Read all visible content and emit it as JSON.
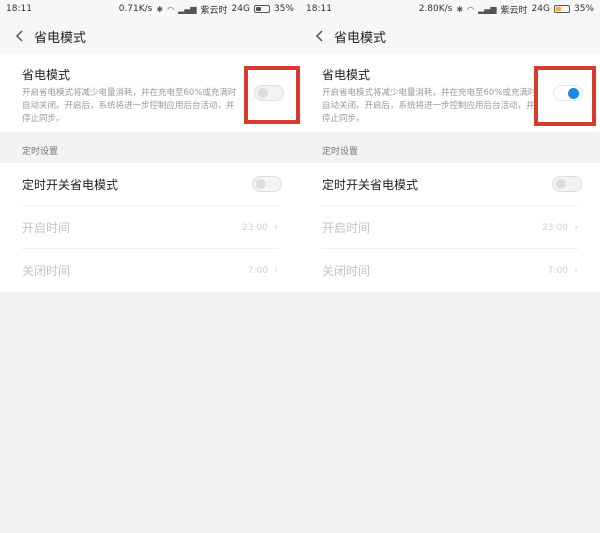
{
  "left": {
    "status": {
      "time": "18:11",
      "speed": "0.71K/s",
      "carrier": "紫云时",
      "network": "24G",
      "battery": "35%"
    },
    "header": {
      "title": "省电模式"
    },
    "main": {
      "label": "省电模式",
      "desc": "开启省电模式将减少电量消耗，并在充电至60%或充满时自动关闭。开启后，系统将进一步控制应用后台活动，并停止同步。",
      "toggle_on": false
    },
    "schedule": {
      "section_title": "定时设置",
      "toggle_label": "定时开关省电模式",
      "open_label": "开启时间",
      "open_value": "23:00",
      "close_label": "关闭时间",
      "close_value": "7:00"
    }
  },
  "right": {
    "status": {
      "time": "18:11",
      "speed": "2.80K/s",
      "carrier": "紫云时",
      "network": "24G",
      "battery": "35%"
    },
    "header": {
      "title": "省电模式"
    },
    "main": {
      "label": "省电模式",
      "desc": "开启省电模式将减少电量消耗，并在充电至60%或充满时自动关闭。开启后，系统将进一步控制应用后台活动，并停止同步。",
      "toggle_on": true
    },
    "schedule": {
      "section_title": "定时设置",
      "toggle_label": "定时开关省电模式",
      "open_label": "开启时间",
      "open_value": "23:00",
      "close_label": "关闭时间",
      "close_value": "7:00"
    }
  },
  "colors": {
    "highlight": "#d63b2e",
    "toggle_on": "#1e88e5",
    "battery_low": "#f5a623"
  }
}
